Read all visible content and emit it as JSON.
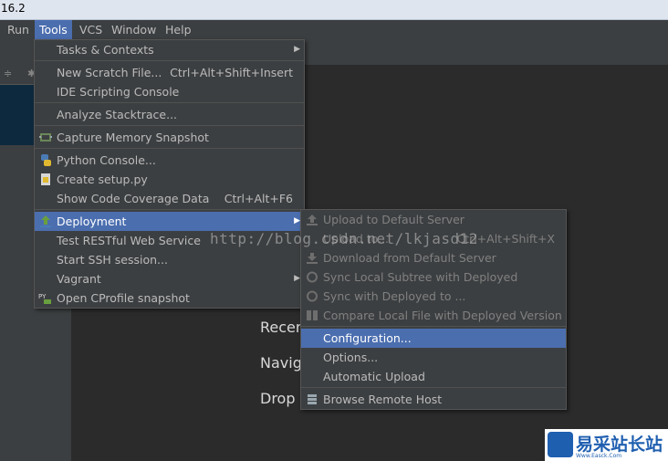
{
  "title": {
    "version": "16.2"
  },
  "menubar": {
    "items": [
      {
        "label": "Run"
      },
      {
        "label": "Tools"
      },
      {
        "label": "VCS"
      },
      {
        "label": "Window"
      },
      {
        "label": "Help"
      }
    ]
  },
  "editor": {
    "hints": [
      "Recen",
      "Navig",
      "Drop"
    ]
  },
  "tools_menu": {
    "items": [
      {
        "label": "Tasks & Contexts",
        "shortcut": "",
        "submenu": true
      },
      {
        "label": "New Scratch File...",
        "shortcut": "Ctrl+Alt+Shift+Insert"
      },
      {
        "label": "IDE Scripting Console",
        "shortcut": ""
      },
      {
        "label": "Analyze Stacktrace...",
        "shortcut": ""
      },
      {
        "label": "Capture Memory Snapshot",
        "shortcut": ""
      },
      {
        "label": "Python Console...",
        "shortcut": ""
      },
      {
        "label": "Create setup.py",
        "shortcut": ""
      },
      {
        "label": "Show Code Coverage Data",
        "shortcut": "Ctrl+Alt+F6"
      },
      {
        "label": "Deployment",
        "shortcut": "",
        "submenu": true
      },
      {
        "label": "Test RESTful Web Service",
        "shortcut": ""
      },
      {
        "label": "Start SSH session...",
        "shortcut": ""
      },
      {
        "label": "Vagrant",
        "shortcut": "",
        "submenu": true
      },
      {
        "label": "Open CProfile snapshot",
        "shortcut": ""
      }
    ]
  },
  "deployment_menu": {
    "items": [
      {
        "label": "Upload to Default Server",
        "shortcut": ""
      },
      {
        "label": "Upload to...",
        "shortcut": "Ctrl+Alt+Shift+X"
      },
      {
        "label": "Download from Default Server",
        "shortcut": ""
      },
      {
        "label": "Sync Local Subtree with Deployed",
        "shortcut": ""
      },
      {
        "label": "Sync with Deployed to ...",
        "shortcut": ""
      },
      {
        "label": "Compare Local File with Deployed Version",
        "shortcut": ""
      },
      {
        "label": "Configuration...",
        "shortcut": ""
      },
      {
        "label": "Options...",
        "shortcut": ""
      },
      {
        "label": "Automatic Upload",
        "shortcut": ""
      },
      {
        "label": "Browse Remote Host",
        "shortcut": ""
      }
    ]
  },
  "watermark": "http://blog.csdn.net/lkjasd12",
  "logo": {
    "text": "易采站长站",
    "sub": "Www.Easck.Com"
  },
  "colors": {
    "selection": "#4b6eaf",
    "menu_bg": "#3c3f41"
  }
}
